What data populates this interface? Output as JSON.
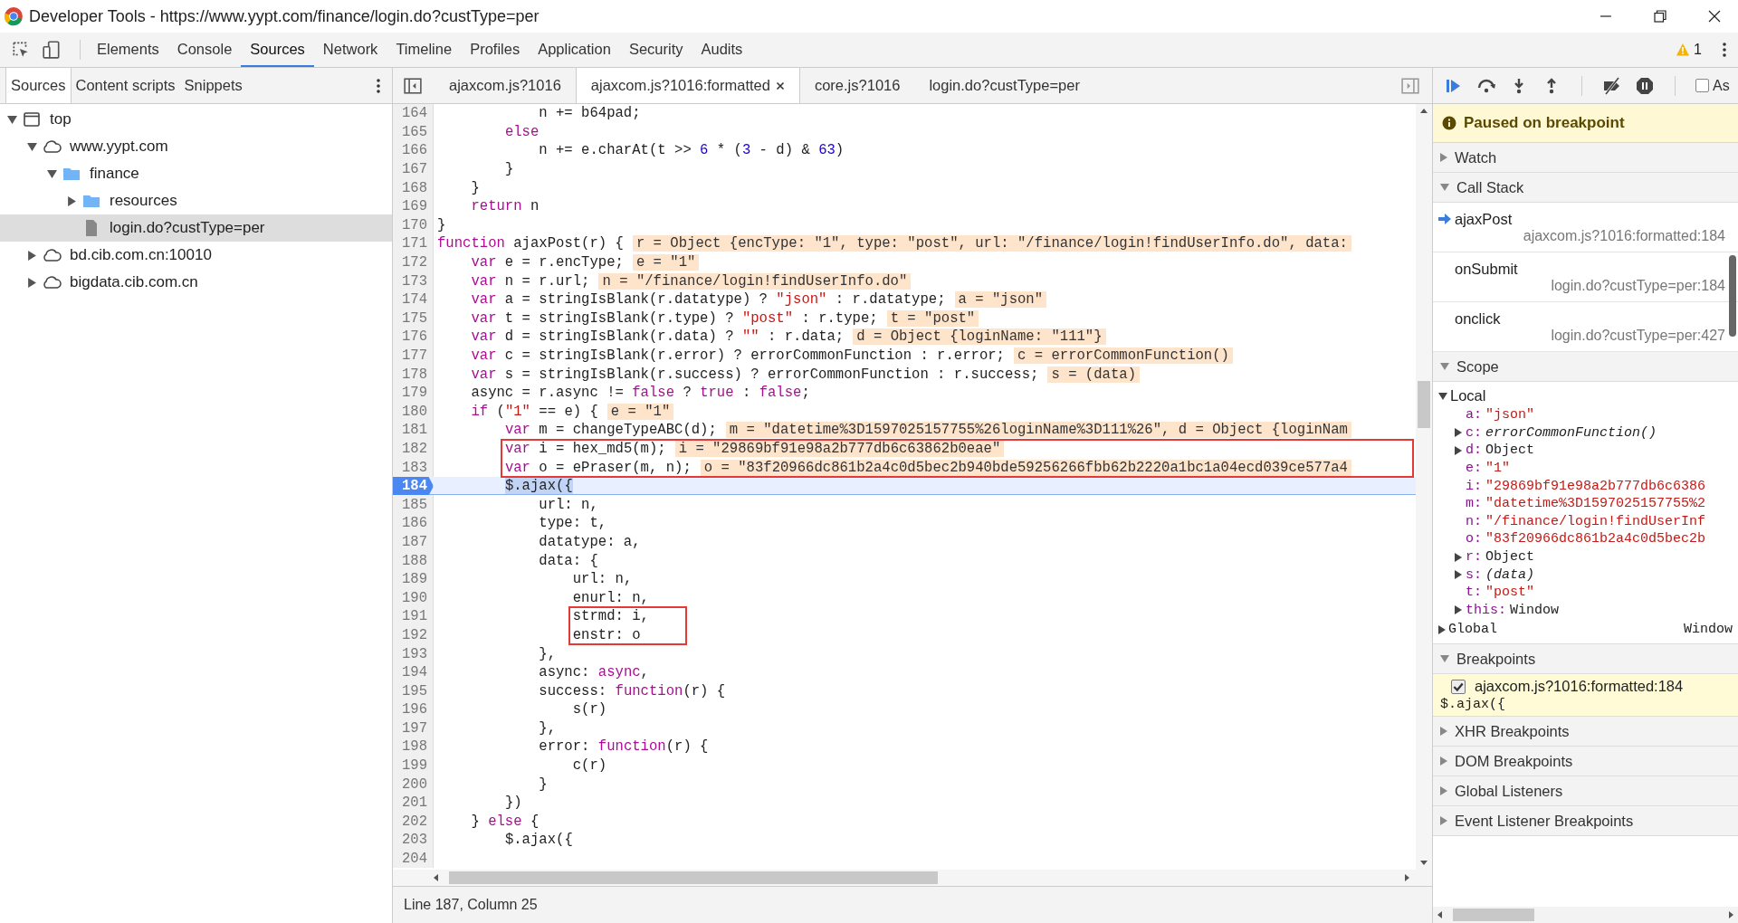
{
  "window": {
    "title": "Developer Tools - https://www.yypt.com/finance/login.do?custType=per"
  },
  "main_tabs": [
    {
      "label": "Elements",
      "selected": false
    },
    {
      "label": "Console",
      "selected": false
    },
    {
      "label": "Sources",
      "selected": true
    },
    {
      "label": "Network",
      "selected": false
    },
    {
      "label": "Timeline",
      "selected": false
    },
    {
      "label": "Profiles",
      "selected": false
    },
    {
      "label": "Application",
      "selected": false
    },
    {
      "label": "Security",
      "selected": false
    },
    {
      "label": "Audits",
      "selected": false
    }
  ],
  "warnings": {
    "count": "1"
  },
  "navigator": {
    "tabs": [
      {
        "label": "Sources",
        "selected": true
      },
      {
        "label": "Content scripts",
        "selected": false
      },
      {
        "label": "Snippets",
        "selected": false
      }
    ],
    "tree": [
      {
        "kind": "frame",
        "label": "top",
        "expanded": true,
        "selected": false,
        "children": [
          {
            "kind": "domain",
            "label": "www.yypt.com",
            "expanded": true,
            "selected": false,
            "children": [
              {
                "kind": "folder",
                "label": "finance",
                "expanded": true,
                "selected": false,
                "children": [
                  {
                    "kind": "folder",
                    "label": "resources",
                    "expanded": false,
                    "selected": false
                  },
                  {
                    "kind": "file",
                    "label": "login.do?custType=per",
                    "selected": true
                  }
                ]
              }
            ]
          },
          {
            "kind": "domain",
            "label": "bd.cib.com.cn:10010",
            "expanded": false,
            "selected": false
          },
          {
            "kind": "domain",
            "label": "bigdata.cib.com.cn",
            "expanded": false,
            "selected": false
          }
        ]
      }
    ]
  },
  "editor": {
    "tabs": [
      {
        "label": "ajaxcom.js?1016",
        "selected": false,
        "closable": false
      },
      {
        "label": "ajaxcom.js?1016:formatted",
        "selected": true,
        "closable": true
      },
      {
        "label": "core.js?1016",
        "selected": false,
        "closable": false
      },
      {
        "label": "login.do?custType=per",
        "selected": false,
        "closable": false
      }
    ],
    "lines": [
      {
        "no": "164",
        "code": [
          {
            "kind": "plain",
            "text": "            n += b64pad;"
          }
        ]
      },
      {
        "no": "165",
        "code": [
          {
            "kind": "keyword",
            "text": "        else"
          }
        ]
      },
      {
        "no": "166",
        "code": [
          {
            "kind": "plain",
            "text": "            n += e.charAt(t >> "
          },
          {
            "kind": "number",
            "text": "6"
          },
          {
            "kind": "plain",
            "text": " * ("
          },
          {
            "kind": "number",
            "text": "3"
          },
          {
            "kind": "plain",
            "text": " - d) & "
          },
          {
            "kind": "number",
            "text": "63"
          },
          {
            "kind": "plain",
            "text": ")"
          }
        ]
      },
      {
        "no": "167",
        "code": [
          {
            "kind": "plain",
            "text": "        }"
          }
        ]
      },
      {
        "no": "168",
        "code": [
          {
            "kind": "plain",
            "text": "    }"
          }
        ]
      },
      {
        "no": "169",
        "code": [
          {
            "kind": "keyword",
            "text": "    return"
          },
          {
            "kind": "plain",
            "text": " n"
          }
        ]
      },
      {
        "no": "170",
        "code": [
          {
            "kind": "plain",
            "text": "}"
          }
        ]
      },
      {
        "no": "171",
        "code": [
          {
            "kind": "keyword",
            "text": "function"
          },
          {
            "kind": "plain",
            "text": " ajaxPost(r) {"
          }
        ],
        "value": "r = Object {encType: \"1\", type: \"post\", url: \"/finance/login!findUserInfo.do\", data:"
      },
      {
        "no": "172",
        "code": [
          {
            "kind": "keyword",
            "text": "    var"
          },
          {
            "kind": "plain",
            "text": " e = r.encType;"
          }
        ],
        "value": "e = \"1\""
      },
      {
        "no": "173",
        "code": [
          {
            "kind": "keyword",
            "text": "    var"
          },
          {
            "kind": "plain",
            "text": " n = r.url;"
          }
        ],
        "value": "n = \"/finance/login!findUserInfo.do\""
      },
      {
        "no": "174",
        "code": [
          {
            "kind": "keyword",
            "text": "    var"
          },
          {
            "kind": "plain",
            "text": " a = stringIsBlank(r.datatype) ? "
          },
          {
            "kind": "string",
            "text": "\"json\""
          },
          {
            "kind": "plain",
            "text": " : r.datatype;"
          }
        ],
        "value": "a = \"json\""
      },
      {
        "no": "175",
        "code": [
          {
            "kind": "keyword",
            "text": "    var"
          },
          {
            "kind": "plain",
            "text": " t = stringIsBlank(r.type) ? "
          },
          {
            "kind": "string",
            "text": "\"post\""
          },
          {
            "kind": "plain",
            "text": " : r.type;"
          }
        ],
        "value": "t = \"post\""
      },
      {
        "no": "176",
        "code": [
          {
            "kind": "keyword",
            "text": "    var"
          },
          {
            "kind": "plain",
            "text": " d = stringIsBlank(r.data) ? "
          },
          {
            "kind": "string",
            "text": "\"\""
          },
          {
            "kind": "plain",
            "text": " : r.data;"
          }
        ],
        "value": "d = Object {loginName: \"111\"}"
      },
      {
        "no": "177",
        "code": [
          {
            "kind": "keyword",
            "text": "    var"
          },
          {
            "kind": "plain",
            "text": " c = stringIsBlank(r.error) ? errorCommonFunction : r.error;"
          }
        ],
        "value": "c = errorCommonFunction()"
      },
      {
        "no": "178",
        "code": [
          {
            "kind": "keyword",
            "text": "    var"
          },
          {
            "kind": "plain",
            "text": " s = stringIsBlank(r.success) ? errorCommonFunction : r.success;"
          }
        ],
        "value": "s = (data)"
      },
      {
        "no": "179",
        "code": [
          {
            "kind": "plain",
            "text": "    async = r.async != "
          },
          {
            "kind": "keyword",
            "text": "false"
          },
          {
            "kind": "plain",
            "text": " ? "
          },
          {
            "kind": "keyword",
            "text": "true"
          },
          {
            "kind": "plain",
            "text": " : "
          },
          {
            "kind": "keyword",
            "text": "false"
          },
          {
            "kind": "plain",
            "text": ";"
          }
        ]
      },
      {
        "no": "180",
        "code": [
          {
            "kind": "keyword",
            "text": "    if"
          },
          {
            "kind": "plain",
            "text": " ("
          },
          {
            "kind": "string",
            "text": "\"1\""
          },
          {
            "kind": "plain",
            "text": " == e) {"
          }
        ],
        "value": "e = \"1\""
      },
      {
        "no": "181",
        "code": [
          {
            "kind": "keyword",
            "text": "        var"
          },
          {
            "kind": "plain",
            "text": " m = changeTypeABC(d);"
          }
        ],
        "value": "m = \"datetime%3D1597025157755%26loginName%3D111%26\", d = Object {loginNam"
      },
      {
        "no": "182",
        "boxed": true,
        "code": [
          {
            "kind": "keyword",
            "text": "        var"
          },
          {
            "kind": "plain",
            "text": " i = hex_md5(m);"
          }
        ],
        "value": "i = \"29869bf91e98a2b777db6c63862b0eae\""
      },
      {
        "no": "183",
        "boxed": true,
        "code": [
          {
            "kind": "keyword",
            "text": "        var"
          },
          {
            "kind": "plain",
            "text": " o = ePraser(m, n);"
          }
        ],
        "value": "o = \"83f20966dc861b2a4c0d5bec2b940bde59256266fbb62b2220a1bc1a04ecd039ce577a4"
      },
      {
        "no": "184",
        "current": true,
        "code": [
          {
            "kind": "plain",
            "text": "        $.ajax({"
          }
        ]
      },
      {
        "no": "185",
        "code": [
          {
            "kind": "plain",
            "text": "            url: n,"
          }
        ]
      },
      {
        "no": "186",
        "code": [
          {
            "kind": "plain",
            "text": "            type: t,"
          }
        ]
      },
      {
        "no": "187",
        "code": [
          {
            "kind": "plain",
            "text": "            datatype: a,"
          }
        ]
      },
      {
        "no": "188",
        "code": [
          {
            "kind": "plain",
            "text": "            data: {"
          }
        ]
      },
      {
        "no": "189",
        "code": [
          {
            "kind": "plain",
            "text": "                url: n,"
          }
        ]
      },
      {
        "no": "190",
        "code": [
          {
            "kind": "plain",
            "text": "                enurl: n,"
          }
        ]
      },
      {
        "no": "191",
        "boxed": true,
        "code": [
          {
            "kind": "plain",
            "text": "                strmd: i,"
          }
        ]
      },
      {
        "no": "192",
        "boxed": true,
        "code": [
          {
            "kind": "plain",
            "text": "                enstr: o"
          }
        ]
      },
      {
        "no": "193",
        "code": [
          {
            "kind": "plain",
            "text": "            },"
          }
        ]
      },
      {
        "no": "194",
        "code": [
          {
            "kind": "plain",
            "text": "            async: "
          },
          {
            "kind": "keyword",
            "text": "async"
          },
          {
            "kind": "plain",
            "text": ","
          }
        ]
      },
      {
        "no": "195",
        "code": [
          {
            "kind": "plain",
            "text": "            success: "
          },
          {
            "kind": "keyword",
            "text": "function"
          },
          {
            "kind": "plain",
            "text": "(r) {"
          }
        ]
      },
      {
        "no": "196",
        "code": [
          {
            "kind": "plain",
            "text": "                s(r)"
          }
        ]
      },
      {
        "no": "197",
        "code": [
          {
            "kind": "plain",
            "text": "            },"
          }
        ]
      },
      {
        "no": "198",
        "code": [
          {
            "kind": "plain",
            "text": "            error: "
          },
          {
            "kind": "keyword",
            "text": "function"
          },
          {
            "kind": "plain",
            "text": "(r) {"
          }
        ]
      },
      {
        "no": "199",
        "code": [
          {
            "kind": "plain",
            "text": "                c(r)"
          }
        ]
      },
      {
        "no": "200",
        "code": [
          {
            "kind": "plain",
            "text": "            }"
          }
        ]
      },
      {
        "no": "201",
        "code": [
          {
            "kind": "plain",
            "text": "        })"
          }
        ]
      },
      {
        "no": "202",
        "code": [
          {
            "kind": "plain",
            "text": "    } "
          },
          {
            "kind": "keyword",
            "text": "else"
          },
          {
            "kind": "plain",
            "text": " {"
          }
        ]
      },
      {
        "no": "203",
        "code": [
          {
            "kind": "plain",
            "text": "        $.ajax({"
          }
        ]
      },
      {
        "no": "204"
      }
    ]
  },
  "status_bar": {
    "position": "Line 187, Column 25"
  },
  "debugger": {
    "async_checkbox": {
      "label": "As",
      "checked": false
    },
    "paused_message": "Paused on breakpoint",
    "watch": {
      "title": "Watch",
      "expanded": false
    },
    "call_stack": {
      "title": "Call Stack",
      "expanded": true,
      "frames": [
        {
          "name": "ajaxPost",
          "location": "ajaxcom.js?1016:formatted:184",
          "selected": true
        },
        {
          "name": "onSubmit",
          "location": "login.do?custType=per:184",
          "selected": false
        },
        {
          "name": "onclick",
          "location": "login.do?custType=per:427",
          "selected": false
        }
      ]
    },
    "scope": {
      "title": "Scope",
      "expanded": true,
      "local": {
        "label": "Local",
        "expanded": true,
        "vars": [
          {
            "name": "a:",
            "value": "\"json\"",
            "kind": "string",
            "expandable": false
          },
          {
            "name": "c:",
            "value": "errorCommonFunction()",
            "kind": "function",
            "expandable": true
          },
          {
            "name": "d:",
            "value": "Object",
            "kind": "object",
            "expandable": true
          },
          {
            "name": "e:",
            "value": "\"1\"",
            "kind": "string",
            "expandable": false
          },
          {
            "name": "i:",
            "value": "\"29869bf91e98a2b777db6c6386",
            "kind": "string",
            "expandable": false
          },
          {
            "name": "m:",
            "value": "\"datetime%3D1597025157755%2",
            "kind": "string",
            "expandable": false
          },
          {
            "name": "n:",
            "value": "\"/finance/login!findUserInf",
            "kind": "string",
            "expandable": false
          },
          {
            "name": "o:",
            "value": "\"83f20966dc861b2a4c0d5bec2b",
            "kind": "string",
            "expandable": false
          },
          {
            "name": "r:",
            "value": "Object",
            "kind": "object",
            "expandable": true
          },
          {
            "name": "s:",
            "value": "(data)",
            "kind": "function",
            "expandable": true
          },
          {
            "name": "t:",
            "value": "\"post\"",
            "kind": "string",
            "expandable": false
          },
          {
            "name": "this:",
            "value": "Window",
            "kind": "object",
            "expandable": true
          }
        ]
      },
      "global": {
        "label": "Global",
        "value": "Window",
        "expanded": false
      }
    },
    "breakpoints": {
      "title": "Breakpoints",
      "expanded": true,
      "items": [
        {
          "location": "ajaxcom.js?1016:formatted:184",
          "code": "$.ajax({",
          "checked": true
        }
      ]
    },
    "other_sections": [
      {
        "title": "XHR Breakpoints",
        "expanded": false
      },
      {
        "title": "DOM Breakpoints",
        "expanded": false
      },
      {
        "title": "Global Listeners",
        "expanded": false
      },
      {
        "title": "Event Listener Breakpoints",
        "expanded": false
      }
    ]
  }
}
